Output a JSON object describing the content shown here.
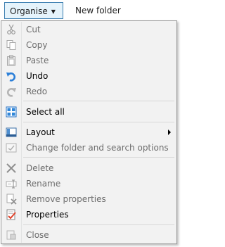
{
  "toolbar": {
    "organise_label": "Organise",
    "organise_arrow": "▼",
    "new_folder_label": "New folder"
  },
  "menu": {
    "items": [
      {
        "label": "Cut",
        "enabled": false,
        "icon": "cut-icon"
      },
      {
        "label": "Copy",
        "enabled": false,
        "icon": "copy-icon"
      },
      {
        "label": "Paste",
        "enabled": false,
        "icon": "paste-icon"
      },
      {
        "label": "Undo",
        "enabled": true,
        "icon": "undo-icon"
      },
      {
        "label": "Redo",
        "enabled": false,
        "icon": "redo-icon"
      },
      {
        "label": "Select all",
        "enabled": true,
        "icon": "select-all-icon"
      },
      {
        "label": "Layout",
        "enabled": true,
        "icon": "layout-icon",
        "submenu": true
      },
      {
        "label": "Change folder and search options",
        "enabled": false,
        "icon": "folder-options-icon"
      },
      {
        "label": "Delete",
        "enabled": false,
        "icon": "delete-icon"
      },
      {
        "label": "Rename",
        "enabled": false,
        "icon": "rename-icon"
      },
      {
        "label": "Remove properties",
        "enabled": false,
        "icon": "remove-properties-icon"
      },
      {
        "label": "Properties",
        "enabled": true,
        "icon": "properties-icon"
      },
      {
        "label": "Close",
        "enabled": false,
        "icon": "close-icon"
      }
    ]
  },
  "colors": {
    "organise_bg": "#e5f3fb",
    "organise_border": "#3c7fb1",
    "menu_bg": "#f2f2f2",
    "disabled_text": "#6d6d6d"
  }
}
